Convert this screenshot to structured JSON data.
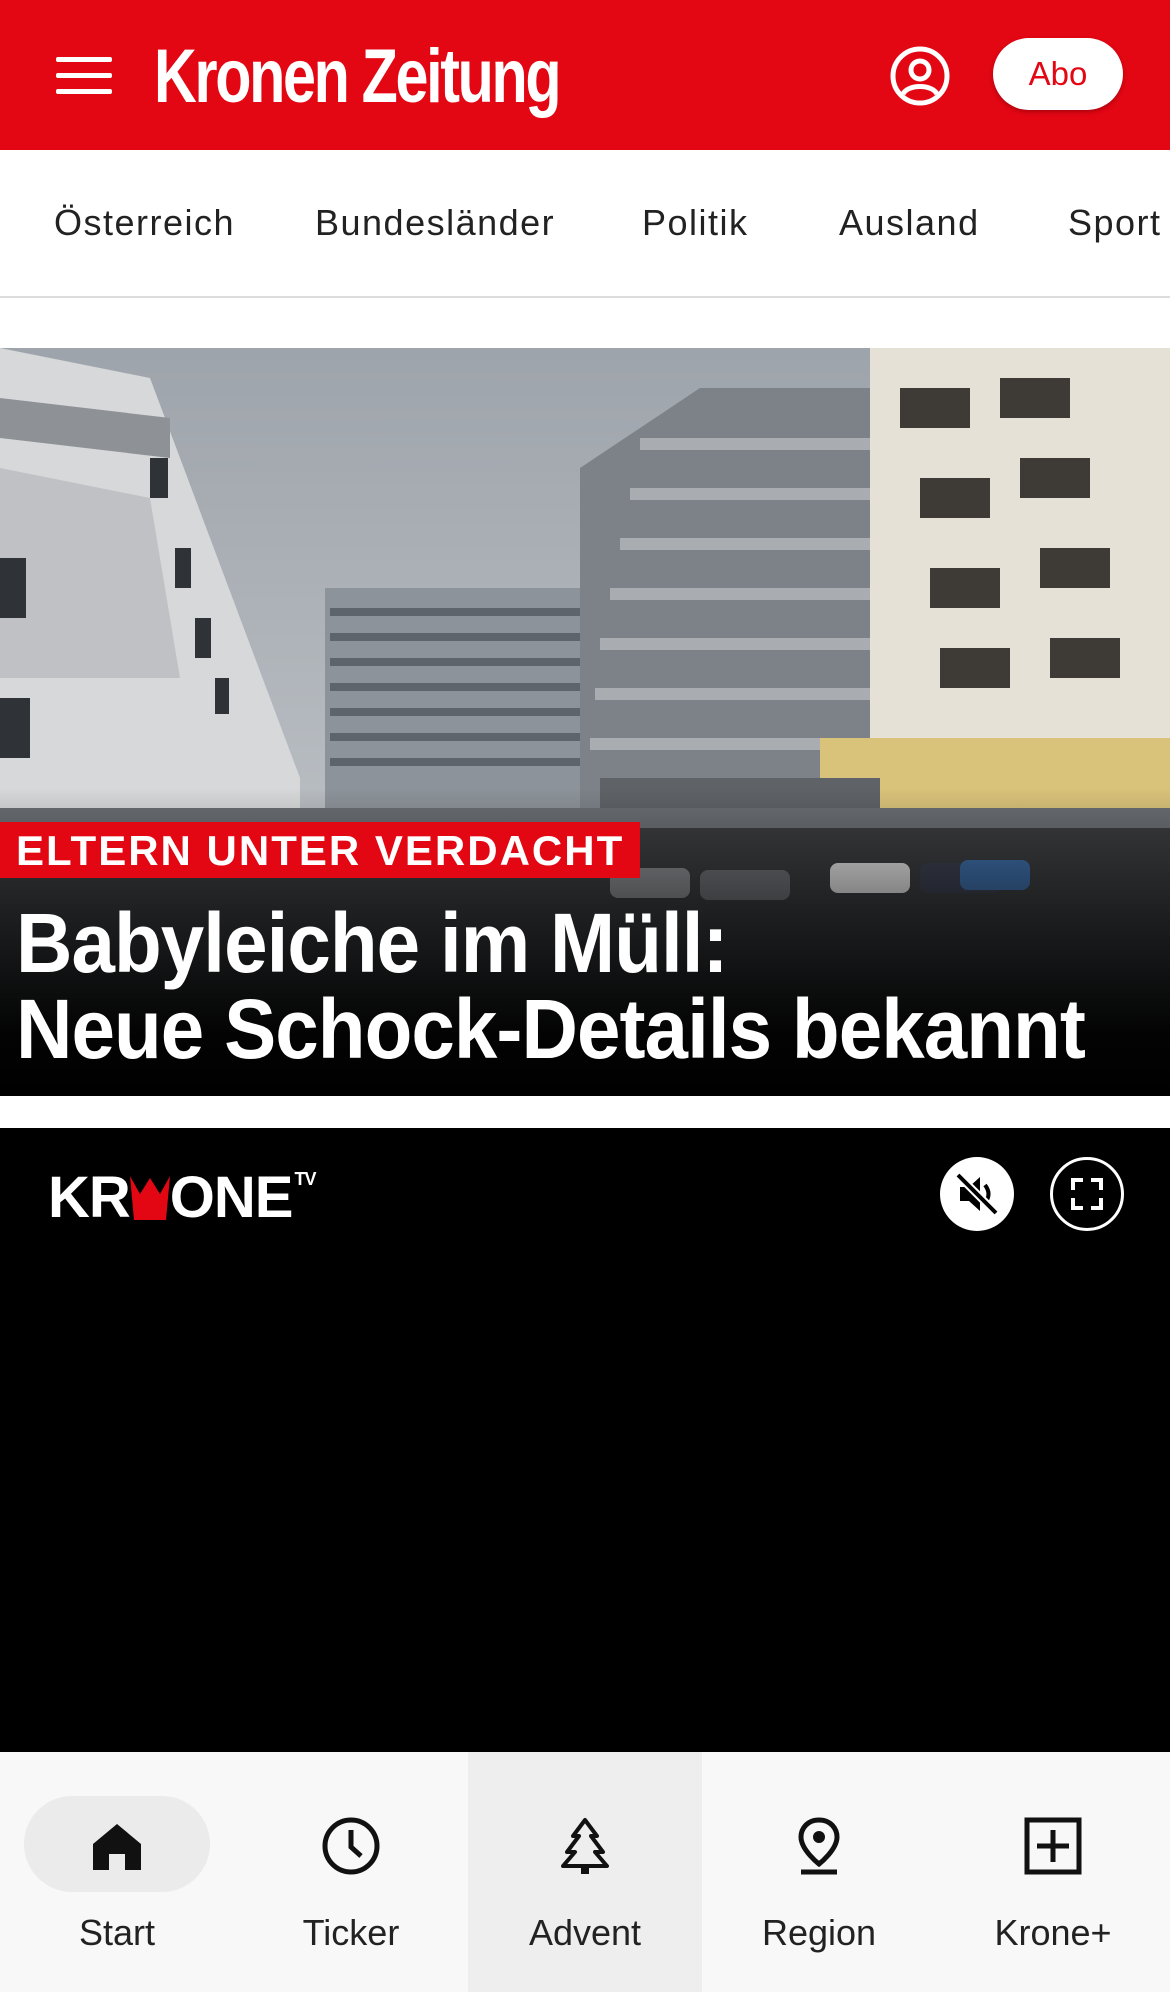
{
  "header": {
    "logo_text": "Kronen Zeitung",
    "abo_label": "Abo",
    "brand_color": "#e30613",
    "menu_icon": "hamburger-menu-icon",
    "account_icon": "user-account-icon"
  },
  "nav": {
    "items": [
      {
        "label": "Österreich"
      },
      {
        "label": "Bundesländer"
      },
      {
        "label": "Politik"
      },
      {
        "label": "Ausland"
      },
      {
        "label": "Sport"
      }
    ]
  },
  "hero": {
    "kicker": "ELTERN UNTER VERDACHT",
    "headline_line1": "Babyleiche im Müll:",
    "headline_line2": "Neue Schock-Details bekannt"
  },
  "video": {
    "logo_left": "KR",
    "logo_right": "ONE",
    "logo_sup": "TV",
    "mute_icon": "muted-speaker-icon",
    "fullscreen_icon": "fullscreen-icon"
  },
  "bottom_nav": {
    "items": [
      {
        "label": "Start",
        "icon": "home-icon",
        "selected": true
      },
      {
        "label": "Ticker",
        "icon": "clock-icon"
      },
      {
        "label": "Advent",
        "icon": "christmas-tree-icon"
      },
      {
        "label": "Region",
        "icon": "location-pin-icon"
      },
      {
        "label": "Krone+",
        "icon": "plus-box-icon"
      }
    ]
  }
}
